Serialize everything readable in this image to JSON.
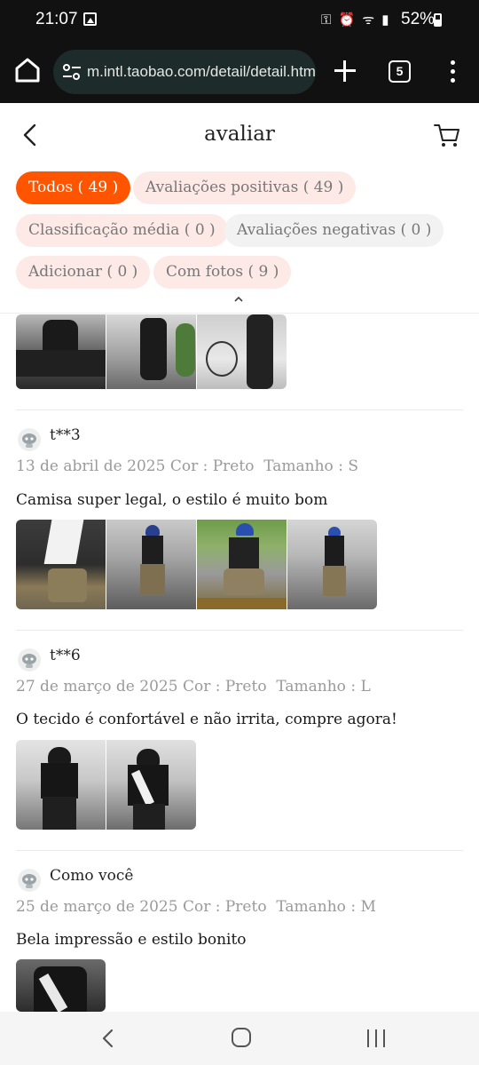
{
  "status_bar": {
    "time": "21:07",
    "system_icons": "⚿ ⏰ ᯤ ▮",
    "battery": "52%"
  },
  "browser": {
    "url": "m.intl.taobao.com/detail/detail.htm",
    "tab_count": "5"
  },
  "header": {
    "title": "avaliar"
  },
  "filters": [
    {
      "label": "Todos ( 49 )",
      "active": true
    },
    {
      "label": "Avaliações positivas ( 49 )",
      "active": false
    },
    {
      "label": "Classificação média ( 0 )",
      "active": false
    },
    {
      "label": "Avaliações negativas ( 0 )",
      "active": false
    },
    {
      "label": "Adicionar ( 0 )",
      "active": false
    },
    {
      "label": "Com fotos ( 9 )",
      "active": false
    }
  ],
  "reviews": [
    {
      "user": "t**3",
      "date": "13 de abril de 2025",
      "color": "Cor : Preto",
      "size": "Tamanho : S",
      "text": "Camisa super legal, o estilo é muito bom"
    },
    {
      "user": "t**6",
      "date": "27 de março de 2025",
      "color": "Cor : Preto",
      "size": "Tamanho : L",
      "text": "O tecido é confortável e não irrita, compre agora!"
    },
    {
      "user": "Como você",
      "date": "25 de março de 2025",
      "color": "Cor : Preto",
      "size": "Tamanho : M",
      "text": "Bela impressão e estilo bonito"
    }
  ],
  "colors": {
    "accent": "#ff5500",
    "chip_bg": "#fde9e5",
    "meta_text": "#9a9a9a"
  }
}
